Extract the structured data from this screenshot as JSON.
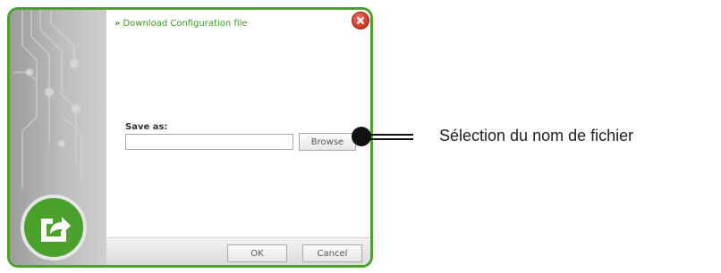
{
  "dialog": {
    "title": "Download Configuration file",
    "title_prefix": "»",
    "save_as_label": "Save as:",
    "save_as_value": "",
    "browse_label": "Browse",
    "ok_label": "OK",
    "cancel_label": "Cancel"
  },
  "annotation": {
    "callout_text": "Sélection du nom de fichier"
  },
  "colors": {
    "accent_green": "#4aa12c",
    "title_green": "#3d9a21",
    "close_red": "#d23b28"
  },
  "icons": {
    "close": "close-icon",
    "logo": "export-share-icon"
  }
}
